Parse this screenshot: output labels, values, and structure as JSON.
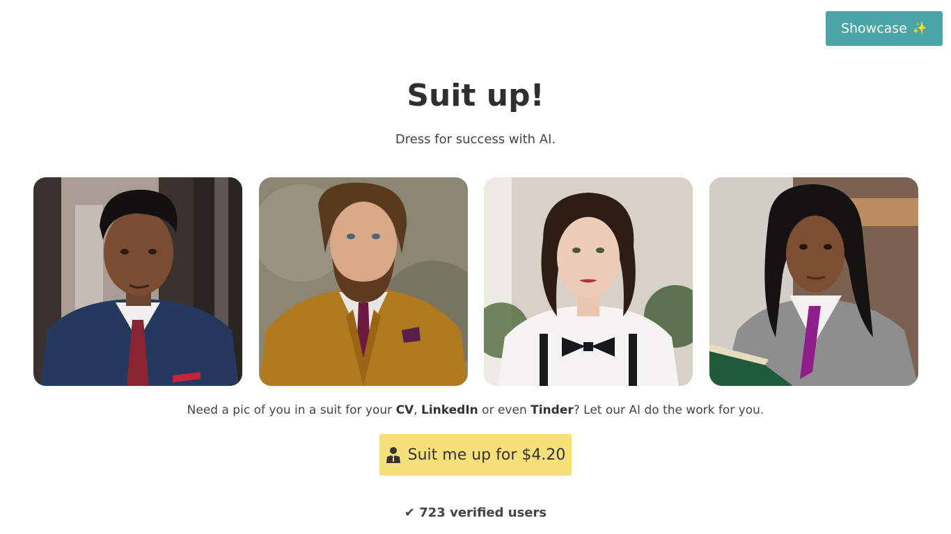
{
  "header": {
    "showcase_label": "Showcase",
    "showcase_icon": "sparkles-icon"
  },
  "hero": {
    "title": "Suit up!",
    "subtitle": "Dress for success with AI."
  },
  "gallery": {
    "items": [
      {
        "subject": "man-blue-suit-red-tie"
      },
      {
        "subject": "bearded-man-mustard-suit"
      },
      {
        "subject": "woman-white-shirt-bowtie"
      },
      {
        "subject": "woman-grey-blazer-book"
      }
    ]
  },
  "tagline": {
    "prefix": "Need a pic of you in a suit for your ",
    "cv": "CV",
    "sep1": ", ",
    "linkedin": "LinkedIn",
    "sep2": " or even ",
    "tinder": "Tinder",
    "suffix": "? Let our AI do the work for you."
  },
  "cta": {
    "label": "Suit me up for $4.20",
    "icon": "user-in-suit-icon"
  },
  "social_proof": {
    "icon": "check-icon",
    "check": "✔",
    "text": "723 verified users"
  },
  "colors": {
    "accent": "#4aa6a6",
    "cta": "#f5e07a"
  }
}
